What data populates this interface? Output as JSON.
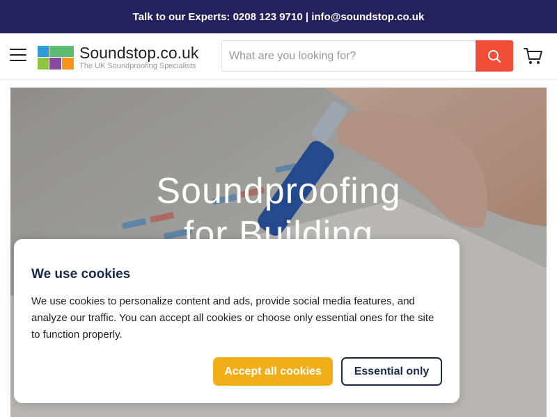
{
  "announcement": {
    "text": "Talk to our Experts: 0208 123 9710 | info@soundstop.co.uk"
  },
  "header": {
    "logo_name": "Soundstop.co.uk",
    "logo_tagline": "The UK Soundproofing Specialists",
    "search_placeholder": "What are you looking for?",
    "search_value": ""
  },
  "hero": {
    "title_line1": "Soundproofing",
    "title_line2": "for Building"
  },
  "cookie_banner": {
    "title": "We use cookies",
    "text": "We use cookies to personalize content and ads, provide social media features, and analyze our traffic. You can accept all cookies or choose only essential ones for the site to function properly.",
    "accept_label": "Accept all cookies",
    "essential_label": "Essential only"
  },
  "colors": {
    "topbar": "#24215f",
    "search_button": "#f04e37",
    "accept_button": "#f1ae18",
    "navy_text": "#1a2b4a"
  },
  "icons": [
    "hamburger-menu-icon",
    "search-icon",
    "cart-icon"
  ]
}
